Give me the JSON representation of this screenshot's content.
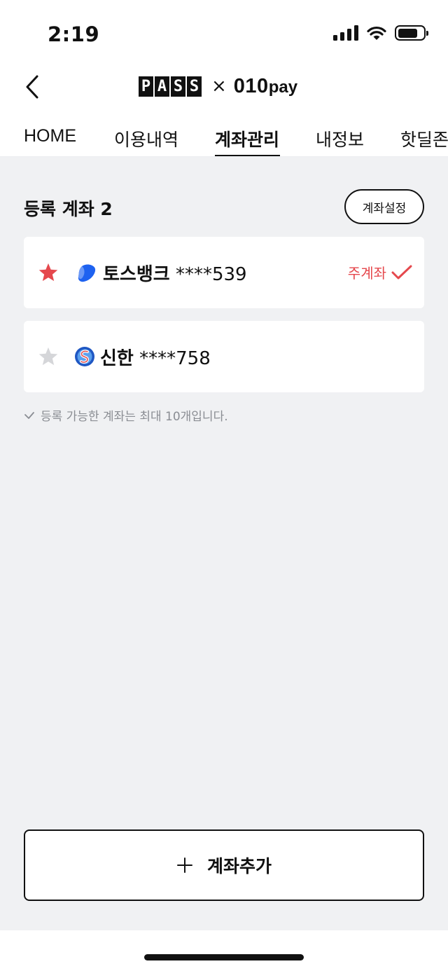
{
  "status_bar": {
    "time": "2:19"
  },
  "header": {
    "pass_letters": [
      "P",
      "A",
      "S",
      "S"
    ],
    "times_symbol": "×",
    "pay_brand": "010",
    "pay_suffix": "pay"
  },
  "tabs": [
    {
      "label": "HOME"
    },
    {
      "label": "이용내역"
    },
    {
      "label": "계좌관리",
      "active": true
    },
    {
      "label": "내정보"
    },
    {
      "label": "핫딜존"
    }
  ],
  "accounts_section": {
    "title": "등록 계좌 2",
    "settings_label": "계좌설정",
    "accounts": [
      {
        "bank": "토스뱅크",
        "masked_number": "****539",
        "starred": true,
        "main_label": "주계좌",
        "bank_icon": "toss-bank-icon"
      },
      {
        "bank": "신한",
        "masked_number": "****758",
        "starred": false,
        "bank_icon": "shinhan-bank-icon"
      }
    ],
    "notice": "등록 가능한 계좌는 최대 10개입니다."
  },
  "add_button": {
    "label": "계좌추가"
  },
  "colors": {
    "accent_red": "#e5484d",
    "background": "#f0f1f3",
    "star_inactive": "#d5d6d9"
  }
}
